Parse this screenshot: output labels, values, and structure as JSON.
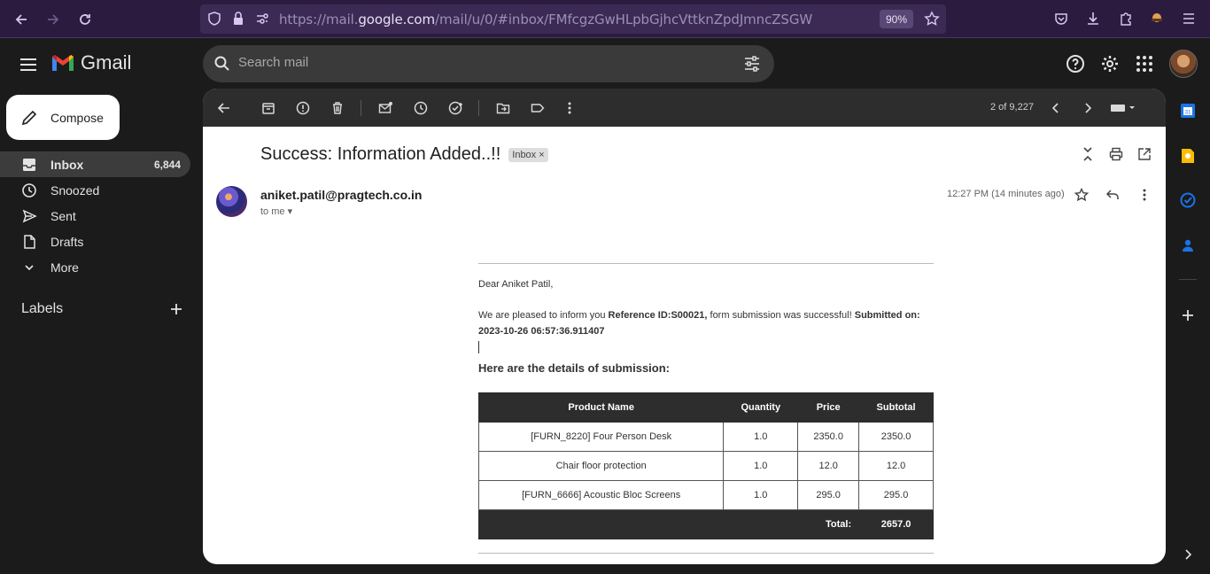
{
  "browser": {
    "url_prefix": "https://mail.",
    "url_domain": "google.com",
    "url_path": "/mail/u/0/#inbox/FMfcgzGwHLpbGjhcVttknZpdJmncZSGW",
    "zoom": "90%"
  },
  "gmail": {
    "brand": "Gmail",
    "search_placeholder": "Search mail"
  },
  "sidebar": {
    "compose_label": "Compose",
    "items": [
      {
        "label": "Inbox",
        "count": "6,844",
        "icon": "inbox-icon"
      },
      {
        "label": "Snoozed",
        "count": "",
        "icon": "clock-icon"
      },
      {
        "label": "Sent",
        "count": "",
        "icon": "send-icon"
      },
      {
        "label": "Drafts",
        "count": "",
        "icon": "draft-icon"
      },
      {
        "label": "More",
        "count": "",
        "icon": "chevron-down-icon"
      }
    ],
    "labels_title": "Labels"
  },
  "toolbar": {
    "pager": "2 of 9,227"
  },
  "email": {
    "subject": "Success: Information Added..!!",
    "chip": "Inbox",
    "sender": "aniket.patil@pragtech.co.in",
    "to": "to me",
    "time": "12:27 PM (14 minutes ago)",
    "greeting": "Dear Aniket Patil,",
    "p_intro": "We are pleased to inform you ",
    "p_ref": "Reference ID:S00021,",
    "p_mid": " form submission was successful! ",
    "p_submitted": "Submitted on: 2023-10-26 06:57:36.911407",
    "details_title": "Here are the details of submission:",
    "table_headers": [
      "Product Name",
      "Quantity",
      "Price",
      "Subtotal"
    ],
    "rows": [
      [
        "[FURN_8220] Four Person Desk",
        "1.0",
        "2350.0",
        "2350.0"
      ],
      [
        "Chair floor protection",
        "1.0",
        "12.0",
        "12.0"
      ],
      [
        "[FURN_6666] Acoustic Bloc Screens",
        "1.0",
        "295.0",
        "295.0"
      ]
    ],
    "total_label": "Total:",
    "total_value": "2657.0"
  },
  "colors": {
    "browser_bg": "#2b1b3f",
    "app_bg": "#1b1b1b",
    "panel_bg": "#ffffff",
    "accent_blue": "#1a73e8"
  }
}
